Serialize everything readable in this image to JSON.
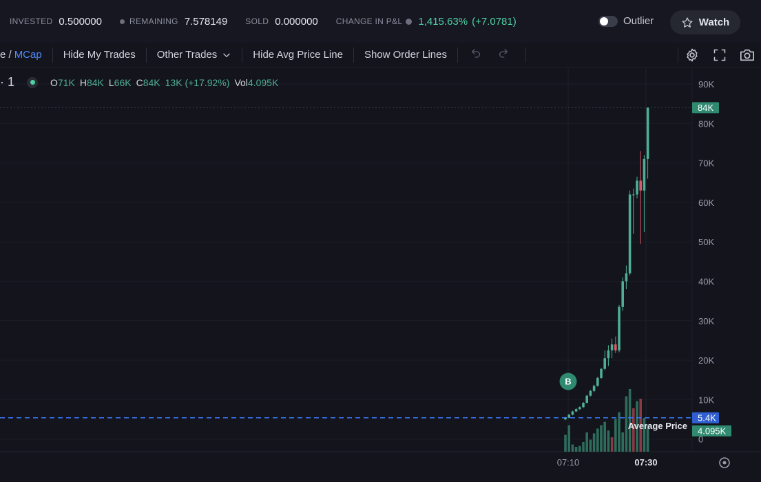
{
  "stats": {
    "invested_label": "INVESTED",
    "invested_value": "0.500000",
    "remaining_label": "REMAINING",
    "remaining_value": "7.578149",
    "sold_label": "SOLD",
    "sold_value": "0.000000",
    "pnl_label": "CHANGE IN P&L",
    "pnl_value": "1,415.63%",
    "pnl_delta": "(+7.0781)"
  },
  "header": {
    "outlier_label": "Outlier",
    "outlier_on": false,
    "watch_label": "Watch"
  },
  "toolbar": {
    "price_prefix": "e /",
    "mcap": "MCap",
    "hide_my_trades": "Hide My Trades",
    "other_trades": "Other Trades",
    "hide_avg_price_line": "Hide Avg Price Line",
    "show_order_lines": "Show Order Lines"
  },
  "legend": {
    "interval": "· 1",
    "o_key": "O",
    "o_val": "71K",
    "h_key": "H",
    "h_val": "84K",
    "l_key": "L",
    "l_val": "66K",
    "c_key": "C",
    "c_val": "84K",
    "change": "13K (+17.92%)",
    "vol_key": "Vol",
    "vol_val": "4.095K"
  },
  "colors": {
    "up": "#4fae93",
    "down": "#d85a6a",
    "avg_line": "#3d7bff",
    "accent_blue": "#4f8bff"
  },
  "chart_data": {
    "type": "candlestick",
    "y_axis_ticks": [
      "90K",
      "80K",
      "70K",
      "60K",
      "50K",
      "40K",
      "30K",
      "20K",
      "10K",
      "0"
    ],
    "ylim": [
      0,
      94000
    ],
    "x_axis_ticks": [
      "07:10",
      "07:30"
    ],
    "last_price_label": "84K",
    "last_price": 84000,
    "avg_price_label": "5.4K",
    "avg_price": 5400,
    "avg_price_text": "Average Price",
    "volume_label": "4.095K",
    "buy_marker": "B",
    "candles": [
      {
        "o": 5000,
        "h": 5600,
        "l": 4800,
        "c": 5400
      },
      {
        "o": 5400,
        "h": 6400,
        "l": 5300,
        "c": 6200
      },
      {
        "o": 6200,
        "h": 7200,
        "l": 6000,
        "c": 7000
      },
      {
        "o": 7000,
        "h": 7800,
        "l": 6900,
        "c": 7600
      },
      {
        "o": 7600,
        "h": 8300,
        "l": 7400,
        "c": 8100
      },
      {
        "o": 8100,
        "h": 9400,
        "l": 7900,
        "c": 9200
      },
      {
        "o": 9200,
        "h": 11200,
        "l": 9000,
        "c": 11000
      },
      {
        "o": 11000,
        "h": 12500,
        "l": 10800,
        "c": 12200
      },
      {
        "o": 12200,
        "h": 13800,
        "l": 11900,
        "c": 13500
      },
      {
        "o": 13500,
        "h": 15800,
        "l": 13300,
        "c": 15500
      },
      {
        "o": 15500,
        "h": 18000,
        "l": 15300,
        "c": 17800
      },
      {
        "o": 17800,
        "h": 22500,
        "l": 17500,
        "c": 20500
      },
      {
        "o": 20500,
        "h": 23800,
        "l": 18500,
        "c": 22500
      },
      {
        "o": 22500,
        "h": 25500,
        "l": 20500,
        "c": 24000
      },
      {
        "o": 24000,
        "h": 26000,
        "l": 21800,
        "c": 22500
      },
      {
        "o": 22500,
        "h": 34000,
        "l": 22000,
        "c": 33500
      },
      {
        "o": 33500,
        "h": 41000,
        "l": 32500,
        "c": 40000
      },
      {
        "o": 40000,
        "h": 44000,
        "l": 38000,
        "c": 42000
      },
      {
        "o": 42000,
        "h": 63000,
        "l": 41500,
        "c": 62000
      },
      {
        "o": 62000,
        "h": 63500,
        "l": 52000,
        "c": 62000
      },
      {
        "o": 62000,
        "h": 66500,
        "l": 61000,
        "c": 65500
      },
      {
        "o": 65500,
        "h": 73000,
        "l": 49500,
        "c": 63000
      },
      {
        "o": 63000,
        "h": 72000,
        "l": 52500,
        "c": 71000
      },
      {
        "o": 71000,
        "h": 84000,
        "l": 66000,
        "c": 84000
      }
    ],
    "volumes": [
      {
        "v": 0.35,
        "up": true
      },
      {
        "v": 0.55,
        "up": true
      },
      {
        "v": 0.15,
        "up": true
      },
      {
        "v": 0.1,
        "up": true
      },
      {
        "v": 0.12,
        "up": true
      },
      {
        "v": 0.2,
        "up": true
      },
      {
        "v": 0.4,
        "up": true
      },
      {
        "v": 0.25,
        "up": true
      },
      {
        "v": 0.38,
        "up": true
      },
      {
        "v": 0.48,
        "up": true
      },
      {
        "v": 0.55,
        "up": true
      },
      {
        "v": 0.62,
        "up": true
      },
      {
        "v": 0.44,
        "up": true
      },
      {
        "v": 0.3,
        "up": false
      },
      {
        "v": 0.68,
        "up": true
      },
      {
        "v": 0.82,
        "up": true
      },
      {
        "v": 0.4,
        "up": true
      },
      {
        "v": 1.15,
        "up": true
      },
      {
        "v": 1.3,
        "up": true
      },
      {
        "v": 0.9,
        "up": false
      },
      {
        "v": 1.05,
        "up": true
      },
      {
        "v": 1.1,
        "up": false
      },
      {
        "v": 0.7,
        "up": true
      },
      {
        "v": 0.55,
        "up": true
      }
    ]
  }
}
